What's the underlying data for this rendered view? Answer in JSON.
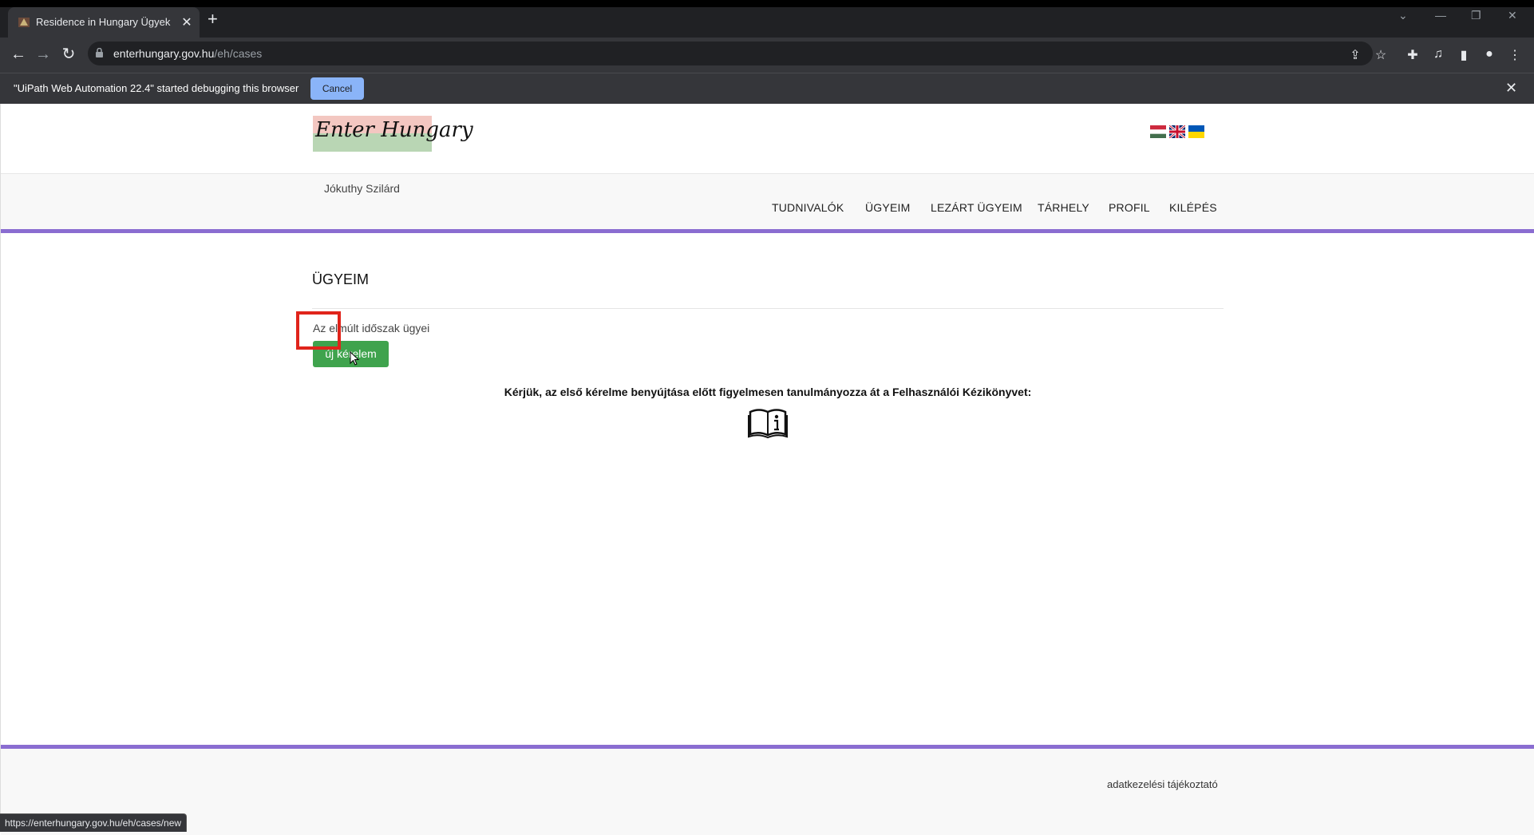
{
  "browser": {
    "tab_title": "Residence in Hungary Ügyek",
    "url_host": "enterhungary.gov.hu",
    "url_path": "/eh/cases",
    "infobar_message": "\"UiPath Web Automation 22.4\" started debugging this browser",
    "infobar_cancel": "Cancel",
    "status_url": "https://enterhungary.gov.hu/eh/cases/new"
  },
  "site": {
    "logo_text": "Enter Hungary",
    "user_name": "Jókuthy Szilárd",
    "nav": [
      "TUDNIVALÓK",
      "ÜGYEIM",
      "LEZÁRT ÜGYEIM",
      "TÁRHELY",
      "PROFIL",
      "KILÉPÉS"
    ],
    "languages": [
      "hu-flag-icon",
      "uk-flag-icon",
      "ua-flag-icon"
    ]
  },
  "main": {
    "title": "ÜGYEIM",
    "subtitle": "Az elmúlt időszak ügyei",
    "new_button": "új kérelem",
    "notice": "Kérjük, az első kérelme benyújtása előtt figyelmesen tanulmányozza át a Felhasználói Kézikönyvet:"
  },
  "footer": {
    "privacy_link": "adatkezelési tájékoztató"
  },
  "colors": {
    "accent_purple": "#8a6dd1",
    "button_green": "#3fa34d",
    "highlight_red": "#e0241b"
  }
}
